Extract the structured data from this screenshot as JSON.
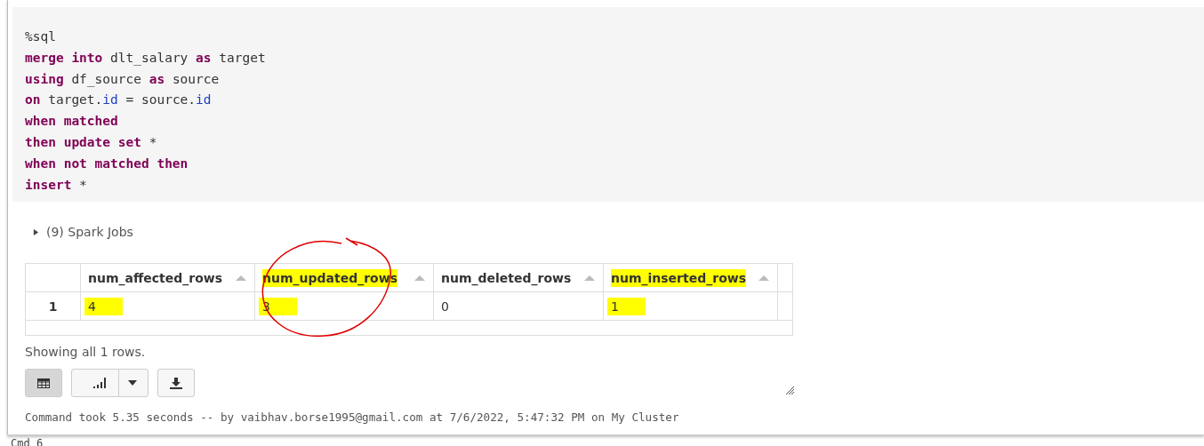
{
  "code": {
    "lines": [
      [
        {
          "text": "%sql",
          "kind": "plain"
        }
      ],
      [
        {
          "text": "merge into",
          "kind": "keyword"
        },
        {
          "text": " dlt_salary ",
          "kind": "plain"
        },
        {
          "text": "as",
          "kind": "keyword"
        },
        {
          "text": " target",
          "kind": "plain"
        }
      ],
      [
        {
          "text": "using",
          "kind": "keyword"
        },
        {
          "text": " df_source ",
          "kind": "plain"
        },
        {
          "text": "as",
          "kind": "keyword"
        },
        {
          "text": " source",
          "kind": "plain"
        }
      ],
      [
        {
          "text": "on",
          "kind": "keyword"
        },
        {
          "text": " target.",
          "kind": "plain"
        },
        {
          "text": "id",
          "kind": "property"
        },
        {
          "text": " = source.",
          "kind": "plain"
        },
        {
          "text": "id",
          "kind": "property"
        }
      ],
      [
        {
          "text": "when matched",
          "kind": "keyword"
        }
      ],
      [
        {
          "text": "then update set",
          "kind": "keyword"
        },
        {
          "text": " *",
          "kind": "plain"
        }
      ],
      [
        {
          "text": "when not matched then",
          "kind": "keyword"
        }
      ],
      [
        {
          "text": "insert",
          "kind": "keyword"
        },
        {
          "text": " *",
          "kind": "plain"
        }
      ]
    ]
  },
  "spark_jobs": {
    "label": "(9) Spark Jobs",
    "expanded": false
  },
  "table": {
    "columns": [
      {
        "name": "num_affected_rows",
        "highlighted": false
      },
      {
        "name": "num_updated_rows",
        "highlighted": true
      },
      {
        "name": "num_deleted_rows",
        "highlighted": false
      },
      {
        "name": "num_inserted_rows",
        "highlighted": true
      }
    ],
    "rows": [
      {
        "index": "1",
        "cells": [
          {
            "text": "4",
            "highlighted": true
          },
          {
            "text": "3",
            "highlighted": true
          },
          {
            "text": "0",
            "highlighted": false
          },
          {
            "text": "1",
            "highlighted": true
          }
        ]
      }
    ]
  },
  "summary": "Showing all 1 rows.",
  "view_buttons": [
    {
      "kind": "table",
      "selected": true
    },
    {
      "kind": "chart",
      "selected": false
    },
    {
      "kind": "download",
      "selected": false
    }
  ],
  "footer": "Command took 5.35 seconds -- by vaibhav.borse1995@gmail.com at 7/6/2022, 5:47:32 PM on My Cluster",
  "next_cell": "Cmd 6"
}
